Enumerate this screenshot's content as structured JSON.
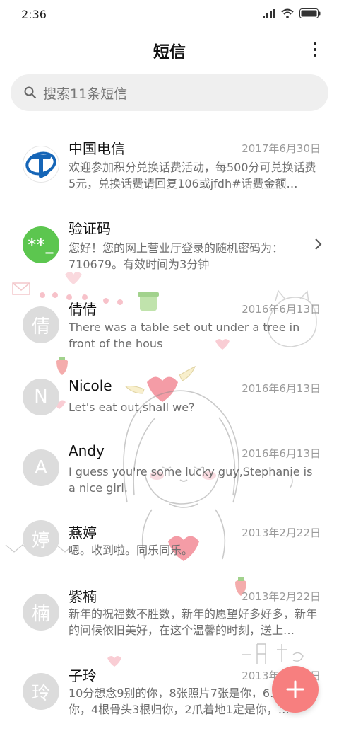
{
  "status_bar": {
    "time": "2:36",
    "icons": [
      "signal-icon",
      "wifi-icon",
      "battery-icon"
    ]
  },
  "header": {
    "title": "短信",
    "menu_icon": "more-vertical-icon"
  },
  "search": {
    "placeholder": "搜索11条短信",
    "icon": "search-icon"
  },
  "conversations": [
    {
      "name": "中国电信",
      "date": "2017年6月30日",
      "preview": "欢迎参加积分兑换话费活动，每500分可兑换话费5元，兑换话费请回复106或jfdh#话费金额…",
      "avatar": "china-telecom-logo"
    },
    {
      "name": "验证码",
      "date": "",
      "preview": "您好！您的网上营业厅登录的随机密码为：710679。有效时间为3分钟",
      "avatar": "**_"
    },
    {
      "name": "倩倩",
      "date": "2016年6月13日",
      "preview": "There was a table set out under a tree in front of the hous",
      "avatar": "倩"
    },
    {
      "name": "Nicole",
      "date": "2016年6月13日",
      "preview": "Let's eat out,shall we?",
      "avatar": "N"
    },
    {
      "name": "Andy",
      "date": "2016年6月13日",
      "preview": "I guess you're some lucky guy,Stephanie is a nice girl.",
      "avatar": "A"
    },
    {
      "name": "燕婷",
      "date": "2013年2月22日",
      "preview": "嗯。收到啦。同乐同乐。",
      "avatar": "婷"
    },
    {
      "name": "紫楠",
      "date": "2013年2月22日",
      "preview": "新年的祝福数不胜数，新年的愿望好多好多，新年的问候依旧美好，在这个温馨的时刻，送上…",
      "avatar": "楠"
    },
    {
      "name": "子玲",
      "date": "2013年2月22日",
      "preview": "10分想念9别的你，8张照片7张是你，6… 只像你，4根骨头3根归你，2爪着地1定是你，…",
      "avatar": "玲"
    }
  ],
  "fab": {
    "icon": "plus-icon"
  },
  "colors": {
    "fab": "#f77f7f",
    "avatar_gray": "#dcdcdc",
    "avatar_green": "#5cc64f",
    "telecom_blue": "#1565b7"
  }
}
